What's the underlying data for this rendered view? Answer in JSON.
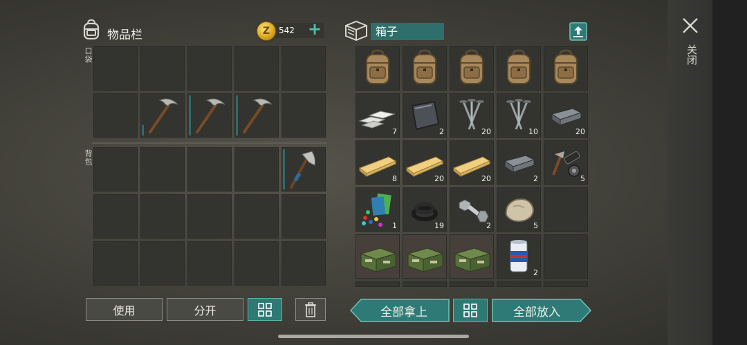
{
  "inventory": {
    "title": "物品栏",
    "coins": "542",
    "pocket_label": "口袋",
    "backpack_label": "背包",
    "buttons": {
      "use": "使用",
      "split": "分开"
    }
  },
  "box": {
    "title": "箱子",
    "take_all": "全部拿上",
    "put_all": "全部放入",
    "close_label": "关闭",
    "items": [
      {
        "icon": "backpack-icon",
        "qty": ""
      },
      {
        "icon": "backpack-icon",
        "qty": ""
      },
      {
        "icon": "backpack-icon",
        "qty": ""
      },
      {
        "icon": "backpack-icon",
        "qty": ""
      },
      {
        "icon": "backpack-icon",
        "qty": ""
      },
      {
        "icon": "metal-bars-icon",
        "qty": "7"
      },
      {
        "icon": "metal-plate-icon",
        "qty": "2"
      },
      {
        "icon": "nails-icon",
        "qty": "20"
      },
      {
        "icon": "nails-icon",
        "qty": "10"
      },
      {
        "icon": "iron-ingot-icon",
        "qty": "20"
      },
      {
        "icon": "plank-icon",
        "qty": "8"
      },
      {
        "icon": "plank-icon",
        "qty": "20"
      },
      {
        "icon": "plank-icon",
        "qty": "20"
      },
      {
        "icon": "iron-ingot-icon",
        "qty": "2"
      },
      {
        "icon": "tool-parts-icon",
        "qty": "5"
      },
      {
        "icon": "plastic-scraps-icon",
        "qty": "1"
      },
      {
        "icon": "rubber-rings-icon",
        "qty": "19"
      },
      {
        "icon": "bolt-nut-icon",
        "qty": "2"
      },
      {
        "icon": "stone-icon",
        "qty": "5"
      },
      {
        "icon": "",
        "qty": ""
      },
      {
        "icon": "ammo-crate-icon",
        "qty": ""
      },
      {
        "icon": "ammo-crate-icon",
        "qty": ""
      },
      {
        "icon": "ammo-crate-icon",
        "qty": ""
      },
      {
        "icon": "beer-can-icon",
        "qty": "2"
      },
      {
        "icon": "",
        "qty": ""
      }
    ]
  },
  "colors": {
    "accent": "#2e7a76",
    "accent_border": "#6cc3b8",
    "slot": "#33342f"
  }
}
